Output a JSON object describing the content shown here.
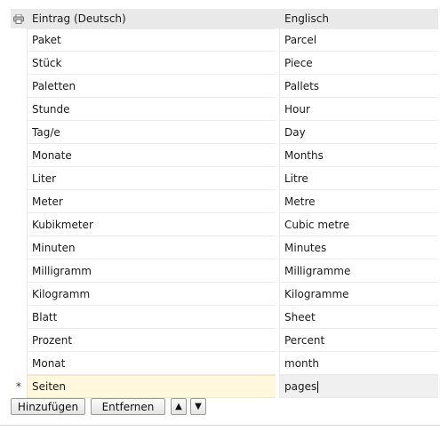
{
  "table": {
    "header": {
      "col1": "Eintrag (Deutsch)",
      "col2": "Englisch",
      "print_icon": "printer-icon"
    },
    "rows": [
      [
        "Paket",
        "Parcel"
      ],
      [
        "Stück",
        "Piece"
      ],
      [
        "Paletten",
        "Pallets"
      ],
      [
        "Stunde",
        "Hour"
      ],
      [
        "Tag/e",
        "Day"
      ],
      [
        "Monate",
        "Months"
      ],
      [
        "Liter",
        "Litre"
      ],
      [
        "Meter",
        "Metre"
      ],
      [
        "Kubikmeter",
        "Cubic metre"
      ],
      [
        "Minuten",
        "Minutes"
      ],
      [
        "Milligramm",
        "Milligramme"
      ],
      [
        "Kilogramm",
        "Kilogramme"
      ],
      [
        "Blatt",
        "Sheet"
      ],
      [
        "Prozent",
        "Percent"
      ],
      [
        "Monat",
        "month"
      ]
    ],
    "new_row": {
      "marker": "*",
      "col1": "Seiten",
      "col2": "pages"
    }
  },
  "toolbar": {
    "add_label": "Hinzufügen",
    "remove_label": "Entfernen",
    "up_icon": "arrow-up-icon",
    "down_icon": "arrow-down-icon"
  },
  "colors": {
    "header_bg": "#e9e9e9",
    "new_row_bg": "#fff8dc",
    "cell_border": "#ebebeb"
  }
}
